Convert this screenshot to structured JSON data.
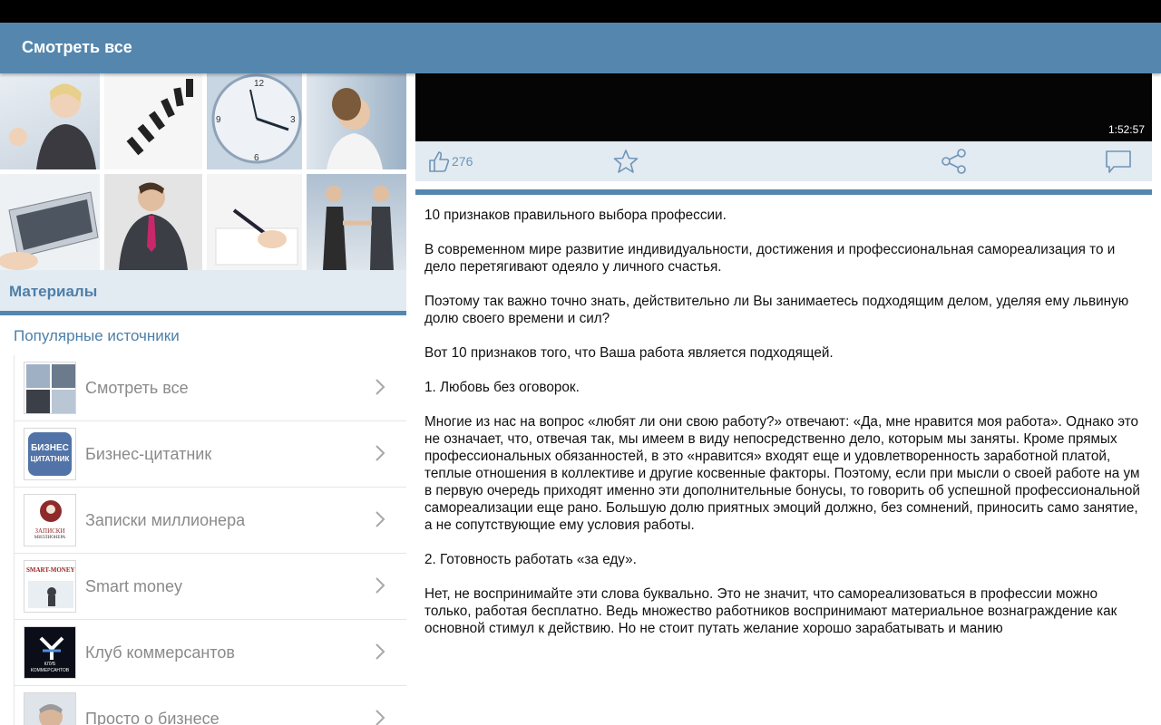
{
  "app_bar": {
    "title": "Смотреть все"
  },
  "materials": {
    "title": "Материалы",
    "sources_title": "Популярные источники",
    "sources": [
      {
        "label": "Смотреть все",
        "icon": "collage-thumb-icon"
      },
      {
        "label": "Бизнес-цитатник",
        "icon": "business-quotes-logo-icon",
        "logo_line1": "БИЗНЕС",
        "logo_line2": "ЦИТАТНИК"
      },
      {
        "label": "Записки миллионера",
        "icon": "millionaire-notes-logo-icon",
        "logo_line1": "ЗАПИСКИ",
        "logo_line2": "МИЛЛИОНЕРА"
      },
      {
        "label": "Smart money",
        "icon": "smart-money-logo-icon",
        "logo_line1": "SMART-MONEY"
      },
      {
        "label": "Клуб коммерсантов",
        "icon": "merchants-club-logo-icon",
        "logo_line1": "КЛУБ",
        "logo_line2": "КОММЕРСАНТОВ"
      },
      {
        "label": "Просто о бизнесе",
        "icon": "simply-business-logo-icon"
      }
    ]
  },
  "video": {
    "duration": "1:52:57"
  },
  "actions": {
    "like_count": "276"
  },
  "colors": {
    "accent": "#5587ae",
    "header_bg": "#e2eaf2"
  },
  "article": {
    "paragraphs": [
      "10 признаков правильного выбора профессии.",
      "В современном мире развитие индивидуальности, достижения и профессиональная самореализация то и дело перетягивают одеяло у личного счастья.",
      "Поэтому так важно точно знать, действительно ли Вы занимаетесь подходящим делом, уделяя ему львиную долю своего времени и сил?",
      "Вот 10 признаков того, что Ваша работа является подходящей.",
      "1. Любовь без оговорок.",
      "Многие из нас на вопрос «любят ли они свою работу?» отвечают: «Да, мне нравится моя работа». Однако это не означает, что, отвечая так, мы имеем в виду непосредственно дело, которым мы заняты. Кроме прямых профессиональных обязанностей, в это «нравится» входят еще и удовлетворенность заработной платой, теплые отношения в коллективе и другие косвенные факторы. Поэтому, если при мысли о своей работе на ум в первую очередь приходят именно эти дополнительные бонусы, то говорить об успешной профессиональной самореализации еще рано. Большую долю приятных эмоций должно, без сомнений, приносить само занятие, а не сопутствующие ему условия работы.",
      "2. Готовность работать «за еду».",
      "Нет, не воспринимайте эти слова буквально. Это не значит, что самореализоваться в профессии можно только, работая бесплатно. Ведь множество работников воспринимают материальное вознаграждение как основной стимул к действию. Но не стоит путать желание хорошо зарабатывать и манию"
    ]
  }
}
